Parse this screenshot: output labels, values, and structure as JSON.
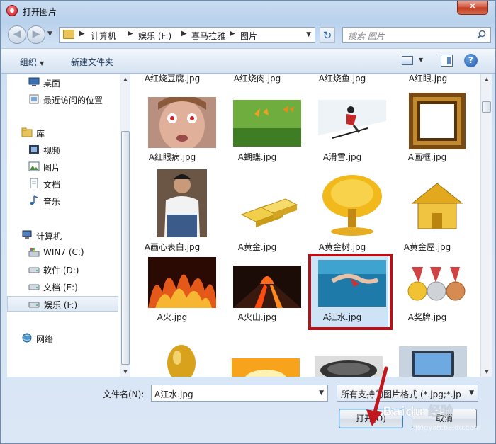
{
  "window": {
    "title": "打开图片",
    "close_glyph": "✕"
  },
  "nav": {
    "back_glyph": "◀",
    "forward_glyph": "▶",
    "breadcrumbs": [
      "计算机",
      "娱乐 (F:)",
      "喜马拉雅",
      "图片"
    ],
    "crumb_separator": "▶",
    "refresh_glyph": "↻",
    "search_placeholder": "搜索 图片"
  },
  "toolbar": {
    "organize_label": "组织",
    "new_folder_label": "新建文件夹",
    "help_glyph": "?"
  },
  "sidebar": {
    "items": [
      {
        "label": "桌面",
        "icon": "desktop-icon"
      },
      {
        "label": "最近访问的位置",
        "icon": "recent-places-icon"
      },
      {
        "label": "库",
        "icon": "libraries-icon"
      },
      {
        "label": "视频",
        "icon": "videos-icon"
      },
      {
        "label": "图片",
        "icon": "pictures-icon"
      },
      {
        "label": "文档",
        "icon": "documents-icon"
      },
      {
        "label": "音乐",
        "icon": "music-icon"
      },
      {
        "label": "计算机",
        "icon": "computer-icon"
      },
      {
        "label": "WIN7 (C:)",
        "icon": "system-drive-icon"
      },
      {
        "label": "软件 (D:)",
        "icon": "drive-icon"
      },
      {
        "label": "文档 (E:)",
        "icon": "drive-icon"
      },
      {
        "label": "娱乐 (F:)",
        "icon": "drive-icon",
        "selected": true
      },
      {
        "label": "网络",
        "icon": "network-icon"
      }
    ]
  },
  "files": {
    "top_row_labels": [
      "A红烧豆腐.jpg",
      "A红烧肉.jpg",
      "A红烧鱼.jpg",
      "A红眼.jpg"
    ],
    "items": [
      {
        "name": "A红眼病.jpg",
        "thumb": "face-thumbnail"
      },
      {
        "name": "A蝴蝶.jpg",
        "thumb": "butterfly-thumbnail"
      },
      {
        "name": "A滑雪.jpg",
        "thumb": "skier-thumbnail"
      },
      {
        "name": "A画框.jpg",
        "thumb": "frame-thumbnail"
      },
      {
        "name": "A画心表白.jpg",
        "thumb": "person-thumbnail"
      },
      {
        "name": "A黄金.jpg",
        "thumb": "gold-bars-thumbnail"
      },
      {
        "name": "A黄金树.jpg",
        "thumb": "gold-tree-thumbnail"
      },
      {
        "name": "A黄金屋.jpg",
        "thumb": "gold-house-thumbnail"
      },
      {
        "name": "A火.jpg",
        "thumb": "fire-thumbnail"
      },
      {
        "name": "A火山.jpg",
        "thumb": "volcano-thumbnail"
      },
      {
        "name": "A江水.jpg",
        "thumb": "swimmer-thumbnail",
        "selected": true
      },
      {
        "name": "A奖牌.jpg",
        "thumb": "medals-thumbnail"
      }
    ]
  },
  "bottom": {
    "filename_label": "文件名(N):",
    "filename_value": "A江水.jpg",
    "filetype_value": "所有支持的图片格式 (*.jpg;*.jp",
    "open_label": "打开(O)",
    "cancel_label": "取消"
  },
  "watermark": {
    "text": "Baidu 经验"
  },
  "colors": {
    "highlight": "#b0141b",
    "selection": "#cfe3f7",
    "accent": "#2a6bb8"
  }
}
